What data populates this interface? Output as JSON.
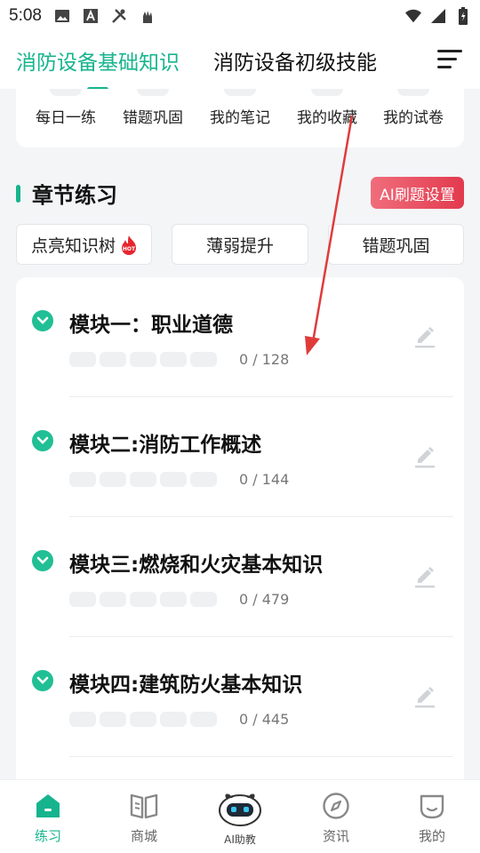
{
  "status_bar": {
    "time": "5:08"
  },
  "header": {
    "tabs": [
      {
        "label": "消防设备基础知识",
        "active": true
      },
      {
        "label": "消防设备初级技能",
        "active": false
      }
    ]
  },
  "tools": [
    "每日一练",
    "错题巩固",
    "我的笔记",
    "我的收藏",
    "我的试卷"
  ],
  "section": {
    "title": "章节练习",
    "ai_button": "AI刷题设置"
  },
  "filters": [
    "点亮知识树",
    "薄弱提升",
    "错题巩固"
  ],
  "hot_badge": "HOT",
  "modules": [
    {
      "title": "模块一：职业道德",
      "progress": "0 / 128"
    },
    {
      "title": "模块二:消防工作概述",
      "progress": "0 / 144"
    },
    {
      "title": "模块三:燃烧和火灾基本知识",
      "progress": "0 / 479"
    },
    {
      "title": "模块四:建筑防火基本知识",
      "progress": "0 / 445"
    }
  ],
  "bottom_nav": [
    {
      "label": "练习",
      "icon": "home-icon",
      "active": true
    },
    {
      "label": "商城",
      "icon": "book-icon",
      "active": false
    },
    {
      "label": "AI助教",
      "icon": "robot-icon",
      "active": false
    },
    {
      "label": "资讯",
      "icon": "compass-icon",
      "active": false
    },
    {
      "label": "我的",
      "icon": "profile-icon",
      "active": false
    }
  ],
  "colors": {
    "accent": "#16b48e",
    "ai_button": "#e23a4e",
    "annotation": "#e03b3b"
  }
}
